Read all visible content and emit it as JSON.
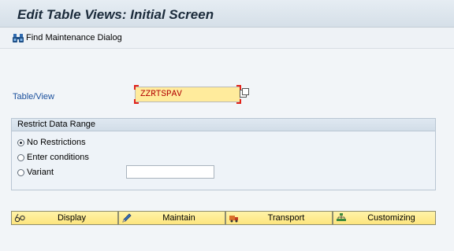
{
  "title": "Edit Table Views: Initial Screen",
  "toolbar": {
    "find_label": "Find Maintenance Dialog"
  },
  "table_view": {
    "label": "Table/View",
    "value": "ZZRTSPAV"
  },
  "restrict": {
    "header": "Restrict Data Range",
    "options": [
      {
        "label": "No Restrictions",
        "selected": true
      },
      {
        "label": "Enter conditions",
        "selected": false
      },
      {
        "label": "Variant",
        "selected": false
      }
    ],
    "variant_value": ""
  },
  "buttons": {
    "display": "Display",
    "maintain": "Maintain",
    "transport": "Transport",
    "customizing": "Customizing"
  },
  "icons": {
    "find": "binoculars-icon",
    "f4": "value-help-icon",
    "display": "glasses-icon",
    "maintain": "pencil-icon",
    "transport": "truck-icon",
    "customizing": "hierarchy-icon"
  },
  "colors": {
    "required_input_bg": "#ffeb9c",
    "required_marker": "#e2231a",
    "button_bg": "#fde57e",
    "label_blue": "#1a4f9c"
  }
}
